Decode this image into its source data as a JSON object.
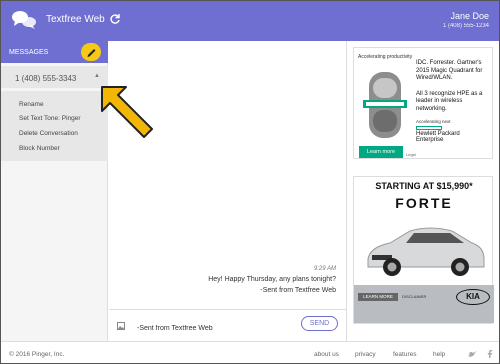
{
  "header": {
    "app_title": "Textfree Web",
    "user_name": "Jane Doe",
    "user_number": "1 (408) 555-1234",
    "icons": [
      "chat-bubbles-logo-icon",
      "refresh-icon"
    ]
  },
  "sidebar": {
    "messages_label": "MESSAGES",
    "compose_icon": "pencil-icon",
    "contact_number": "1 (408) 555-3343",
    "contact_chevron": "▲",
    "menu": [
      "Rename",
      "Set Text Tone: Pinger",
      "Delete Conversation",
      "Block Number"
    ]
  },
  "conversation": {
    "timestamp": "9:29 AM",
    "message_line1": "Hey! Happy Thursday, any plans tonight?",
    "message_line2": "-Sent from Textfree Web",
    "input_value": "-Sent from Textfree Web",
    "send_label": "SEND"
  },
  "ads": {
    "hpe": {
      "small_text": "Accelerating productivity",
      "text1": "IDC. Forrester. Gartner's 2015 Magic Quadrant for Wired/WLAN.",
      "text2": "All 3 recognize HPE as a leader in wireless networking.",
      "accel": "Accelerating next",
      "brand1": "Hewlett Packard",
      "brand2": "Enterprise",
      "learn_more": "Learn more",
      "legal": "Legal"
    },
    "kia": {
      "price": "STARTING AT $15,990*",
      "model": "FORTE",
      "learn_more": "LEARN MORE",
      "disclaimer": "DISCLAIMER",
      "logo": "KIA"
    }
  },
  "footer": {
    "copyright": "© 2016 Pinger, Inc.",
    "links": [
      "about us",
      "privacy",
      "features",
      "help"
    ],
    "social_icons": [
      "twitter-icon",
      "facebook-icon"
    ]
  },
  "colors": {
    "header": "#6e6fd0",
    "accent_yellow": "#f6c915",
    "arrow": "#f2b705",
    "hpe_green": "#01a982"
  }
}
